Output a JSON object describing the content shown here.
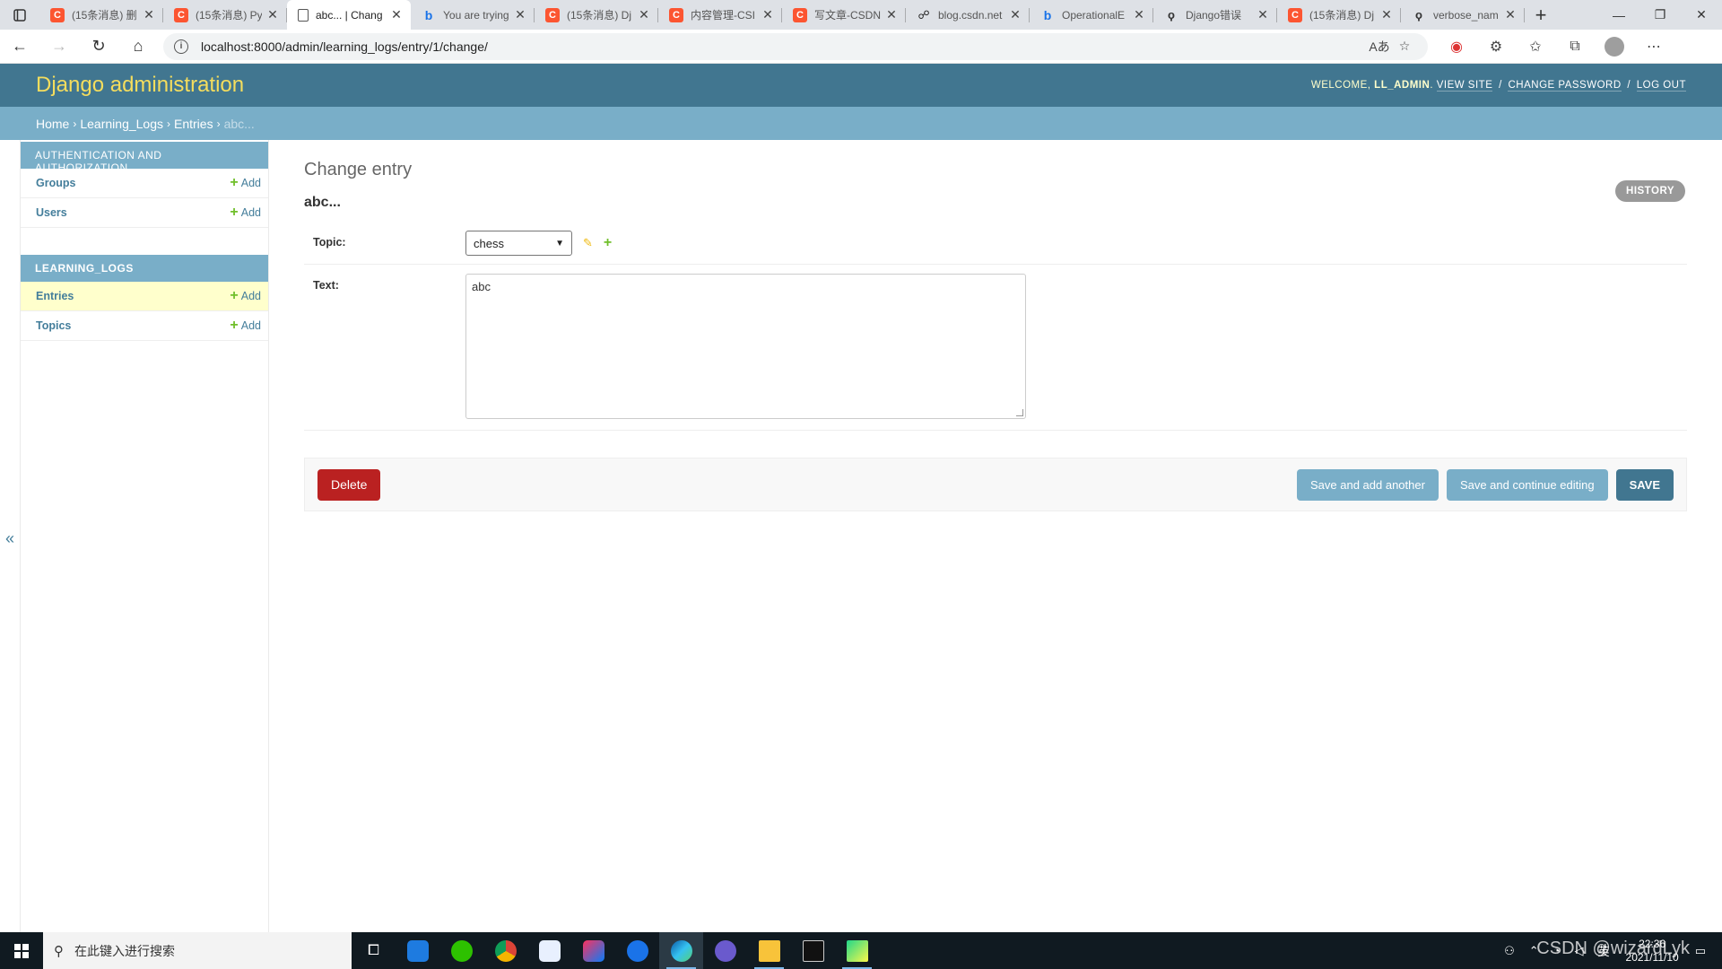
{
  "browser": {
    "tabs": [
      {
        "title": "(15条消息) 删",
        "favicon": "csdn"
      },
      {
        "title": "(15条消息) Py",
        "favicon": "csdn"
      },
      {
        "title": "abc... | Chang",
        "favicon": "doc",
        "active": true
      },
      {
        "title": "You are trying",
        "favicon": "bing"
      },
      {
        "title": "(15条消息) Dj",
        "favicon": "csdn"
      },
      {
        "title": "内容管理-CSI",
        "favicon": "csdn"
      },
      {
        "title": "写文章-CSDN",
        "favicon": "csdn"
      },
      {
        "title": "blog.csdn.net",
        "favicon": "blog"
      },
      {
        "title": "OperationalE",
        "favicon": "bing"
      },
      {
        "title": "Django错误",
        "favicon": "django"
      },
      {
        "title": "(15条消息) Dj",
        "favicon": "csdn"
      },
      {
        "title": "verbose_nam",
        "favicon": "django"
      }
    ],
    "url": "localhost:8000/admin/learning_logs/entry/1/change/"
  },
  "header": {
    "branding": "Django administration",
    "welcome": "WELCOME,",
    "username": "LL_ADMIN",
    "view_site": "VIEW SITE",
    "change_password": "CHANGE PASSWORD",
    "log_out": "LOG OUT"
  },
  "breadcrumbs": {
    "home": "Home",
    "app": "Learning_Logs",
    "model": "Entries",
    "current": "abc..."
  },
  "sidebar": {
    "modules": [
      {
        "caption": "Authentication and Authorization",
        "models": [
          {
            "name": "Groups",
            "add": "Add"
          },
          {
            "name": "Users",
            "add": "Add"
          }
        ]
      },
      {
        "caption": "Learning_Logs",
        "models": [
          {
            "name": "Entries",
            "add": "Add",
            "current": true
          },
          {
            "name": "Topics",
            "add": "Add"
          }
        ]
      }
    ],
    "toggle": "«"
  },
  "content": {
    "title": "Change entry",
    "object": "abc...",
    "history": "HISTORY",
    "fields": {
      "topic_label": "Topic:",
      "topic_value": "chess",
      "text_label": "Text:",
      "text_value": "abc"
    },
    "buttons": {
      "delete": "Delete",
      "save_add": "Save and add another",
      "save_continue": "Save and continue editing",
      "save": "SAVE"
    }
  },
  "taskbar": {
    "search_placeholder": "在此键入进行搜索",
    "clock_time": "22:36",
    "clock_date": "2021/11/10",
    "ime": "英"
  },
  "watermark": "CSDN @wizardLyk",
  "colors": {
    "header_bg": "#417690",
    "breadcrumb_bg": "#79aec8",
    "branding": "#f5dd5d",
    "delete": "#ba2121"
  }
}
